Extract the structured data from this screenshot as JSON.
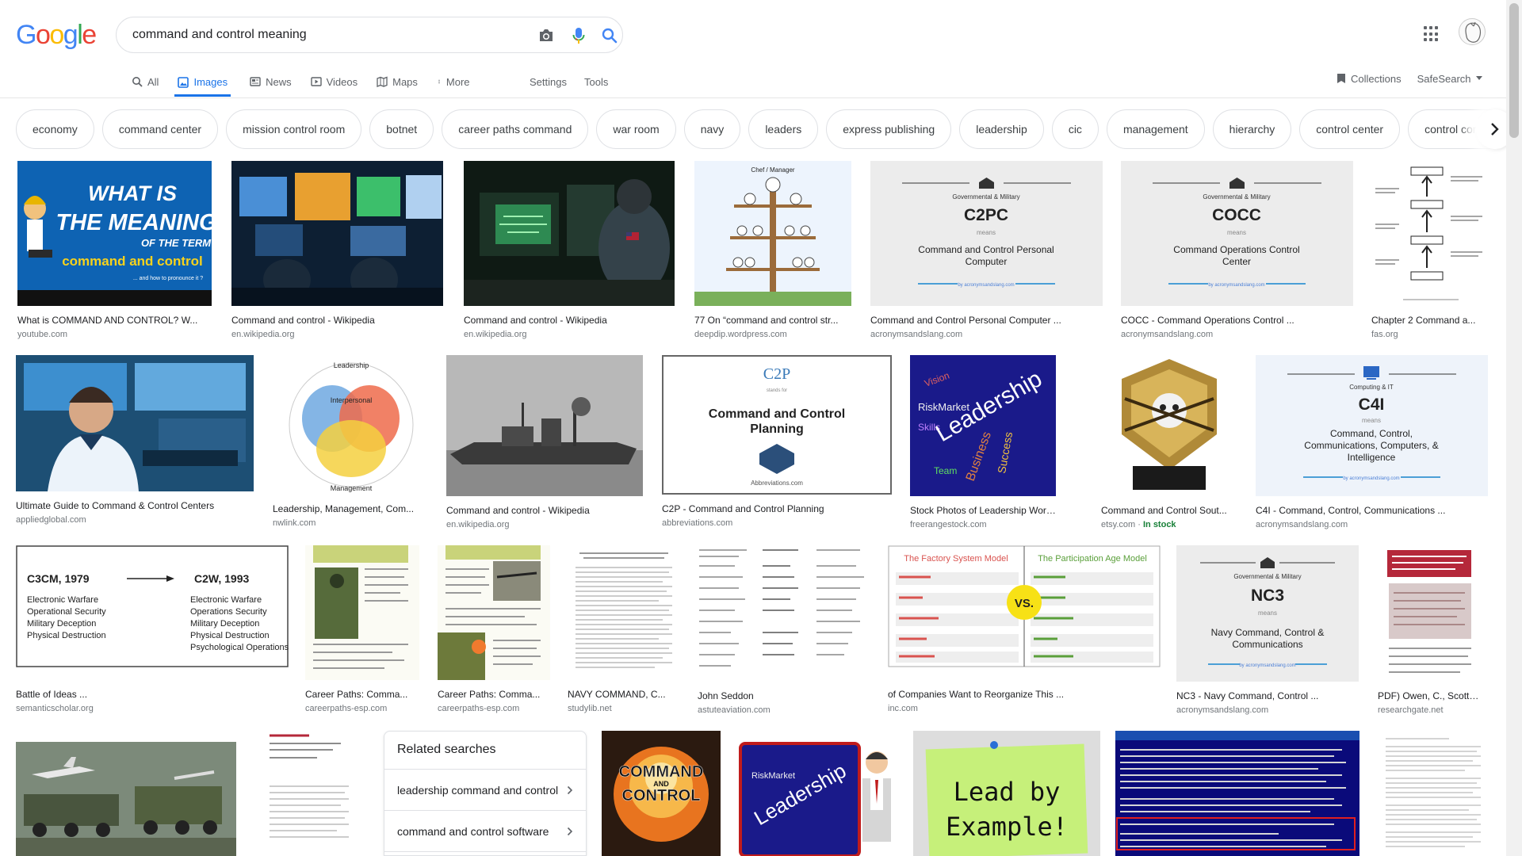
{
  "search": {
    "query": "command and control meaning"
  },
  "tabs": [
    {
      "label": "All",
      "icon": "search-icon"
    },
    {
      "label": "Images",
      "icon": "image-icon",
      "active": true
    },
    {
      "label": "News",
      "icon": "news-icon"
    },
    {
      "label": "Videos",
      "icon": "video-icon"
    },
    {
      "label": "Maps",
      "icon": "map-icon"
    },
    {
      "label": "More",
      "icon": "more-vertical-icon"
    }
  ],
  "tools": {
    "settings": "Settings",
    "tools": "Tools"
  },
  "right_tools": {
    "collections": "Collections",
    "safesearch": "SafeSearch"
  },
  "chips": [
    "economy",
    "command center",
    "mission control room",
    "botnet",
    "career paths command",
    "war room",
    "navy",
    "leaders",
    "express publishing",
    "leadership",
    "cic",
    "management",
    "hierarchy",
    "control center",
    "control commu"
  ],
  "results": [
    {
      "caption": "What is COMMAND AND CONTROL? W...",
      "source": "youtube.com"
    },
    {
      "caption": "Command and control - Wikipedia",
      "source": "en.wikipedia.org"
    },
    {
      "caption": "Command and control - Wikipedia",
      "source": "en.wikipedia.org"
    },
    {
      "caption": "77 On “command and control str...",
      "source": "deepdip.wordpress.com"
    },
    {
      "caption": "Command and Control Personal Computer ...",
      "source": "acronymsandslang.com"
    },
    {
      "caption": "COCC - Command Operations Control ...",
      "source": "acronymsandslang.com"
    },
    {
      "caption": "Chapter 2 Command a...",
      "source": "fas.org"
    },
    {
      "caption": "Ultimate Guide to Command & Control Centers",
      "source": "appliedglobal.com"
    },
    {
      "caption": "Leadership, Management, Com...",
      "source": "nwlink.com"
    },
    {
      "caption": "Command and control - Wikipedia",
      "source": "en.wikipedia.org"
    },
    {
      "caption": "C2P - Command and Control Planning",
      "source": "abbreviations.com"
    },
    {
      "caption": "Stock Photos of Leadership Words ...",
      "source": "freerangestock.com"
    },
    {
      "caption": "Command and Control Sout...",
      "source": "etsy.com",
      "badge": "In stock"
    },
    {
      "caption": "C4I - Command, Control, Communications ...",
      "source": "acronymsandslang.com"
    },
    {
      "caption": "Battle of Ideas ...",
      "source": "semanticscholar.org"
    },
    {
      "caption": "Career Paths: Comma...",
      "source": "careerpaths-esp.com"
    },
    {
      "caption": "Career Paths: Comma...",
      "source": "careerpaths-esp.com"
    },
    {
      "caption": "NAVY COMMAND, C...",
      "source": "studylib.net"
    },
    {
      "caption": "John Seddon",
      "source": "astuteaviation.com"
    },
    {
      "caption": "of Companies Want to Reorganize This ...",
      "source": "inc.com"
    },
    {
      "caption": "NC3 - Navy Command, Control ...",
      "source": "acronymsandslang.com"
    },
    {
      "caption": "PDF) Owen, C., Scott, ...",
      "source": "researchgate.net"
    }
  ],
  "thumb_text": {
    "yt": {
      "line1": "WHAT IS",
      "line2": "THE MEANING",
      "line3": "OF THE TERM",
      "line4": "command and control",
      "line5": "... and how to pronounce it ?"
    },
    "c2pc": {
      "cat": "Governmental & Military",
      "abbr": "C2PC",
      "means": "means",
      "full1": "Command and Control Personal",
      "full2": "Computer",
      "site": "by acronymsandslang.com"
    },
    "cocc": {
      "cat": "Governmental & Military",
      "abbr": "COCC",
      "means": "means",
      "full1": "Command Operations Control",
      "full2": "Center",
      "site": "by acronymsandslang.com"
    },
    "c2p": {
      "abbr": "C2P",
      "stands": "stands for",
      "full1": "Command and Control",
      "full2": "Planning",
      "site": "Abbreviations.com"
    },
    "c4i": {
      "cat": "Computing & IT",
      "abbr": "C4I",
      "means": "means",
      "full1": "Command, Control,",
      "full2": "Communications, Computers, &",
      "full3": "Intelligence",
      "site": "by acronymsandslang.com"
    },
    "nc3": {
      "cat": "Governmental & Military",
      "abbr": "NC3",
      "means": "means",
      "full1": "Navy Command, Control &",
      "full2": "Communications",
      "site": "by acronymsandslang.com"
    },
    "battle": {
      "left_title": "C3CM, 1979",
      "right_title": "C2W, 1993",
      "left": [
        "Electronic Warfare",
        "Operational Security",
        "Military Deception",
        "Physical Destruction"
      ],
      "right": [
        "Electronic Warfare",
        "Operations Security",
        "Military Deception",
        "Physical Destruction",
        "Psychological Operations"
      ]
    },
    "leader_words": "Leadership",
    "lead_example": {
      "line1": "Lead by",
      "line2": "Example!"
    },
    "factory": {
      "left": "The Factory System Model",
      "right": "The Participation Age Model",
      "vs": "VS."
    },
    "cac": {
      "line1": "COMMAND",
      "line2": "AND",
      "line3": "CONTROL"
    },
    "mgmt": {
      "top": "Leadership",
      "center": "Interpersonal",
      "bottom": "Management"
    },
    "chef": {
      "top": "Chef / Manager"
    }
  },
  "related": {
    "title": "Related searches",
    "items": [
      "leadership command and control",
      "command and control software"
    ]
  }
}
